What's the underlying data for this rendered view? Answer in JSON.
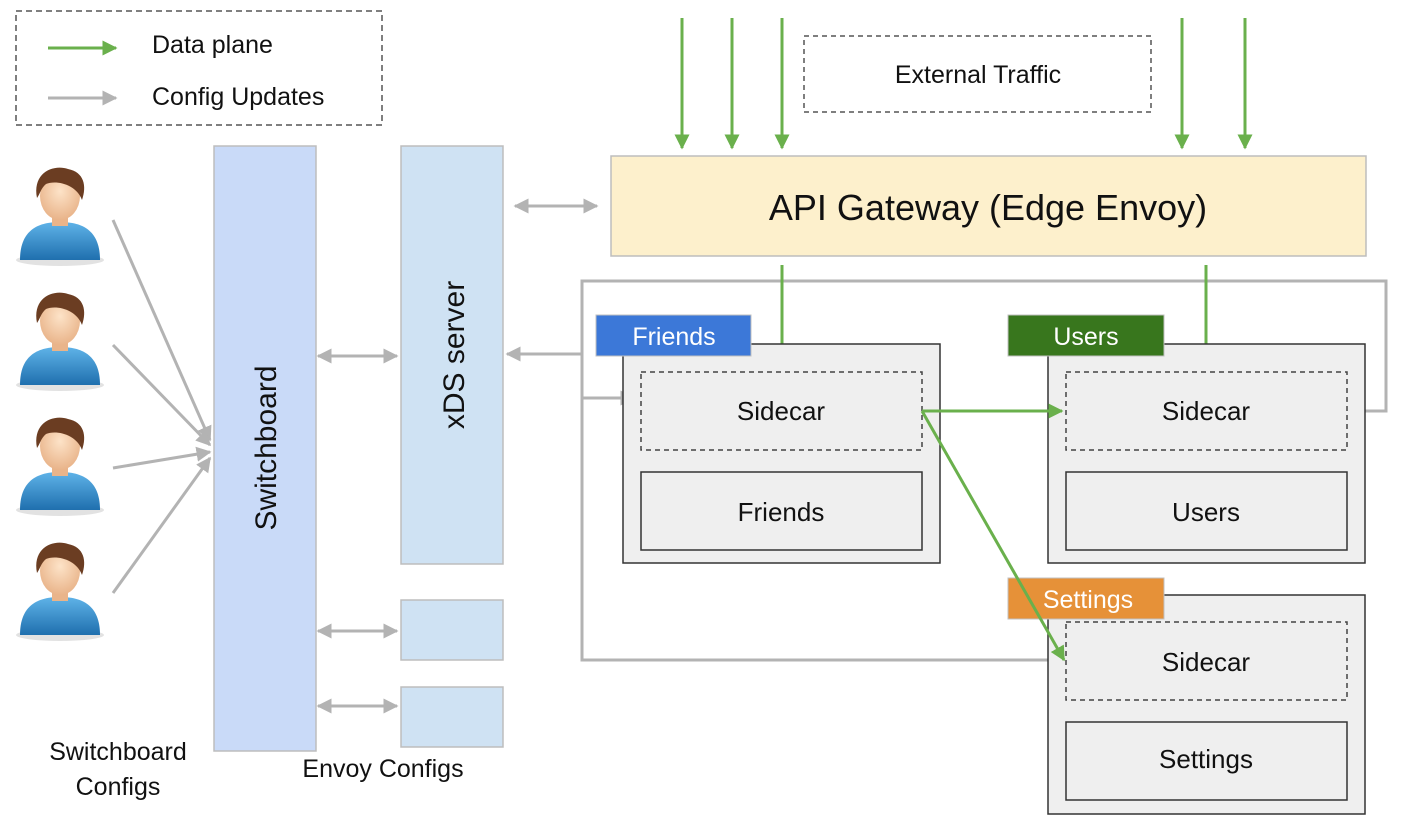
{
  "legend": {
    "items": [
      {
        "label": "Data plane",
        "color": "#6ab04c"
      },
      {
        "label": "Config Updates",
        "color": "#b3b3b3"
      }
    ]
  },
  "external_traffic": "External Traffic",
  "gateway": {
    "label": "API Gateway (Edge Envoy)",
    "fill": "#fdf0cc"
  },
  "switchboard": {
    "label": "Switchboard",
    "fill": "#c9daf8"
  },
  "xds": {
    "label": "xDS server",
    "fill": "#cfe2f3"
  },
  "captions": {
    "switchboard_configs": [
      "Switchboard",
      "Configs"
    ],
    "envoy_configs": "Envoy Configs"
  },
  "users_count": 4,
  "services": [
    {
      "tag": "Friends",
      "tag_color": "#3c78d8",
      "sidecar": "Sidecar",
      "app": "Friends"
    },
    {
      "tag": "Users",
      "tag_color": "#38761d",
      "sidecar": "Sidecar",
      "app": "Users"
    },
    {
      "tag": "Settings",
      "tag_color": "#e69138",
      "sidecar": "Sidecar",
      "app": "Settings"
    }
  ],
  "colors": {
    "data_plane": "#6ab04c",
    "config": "#b3b3b3",
    "service_fill": "#efefef"
  }
}
